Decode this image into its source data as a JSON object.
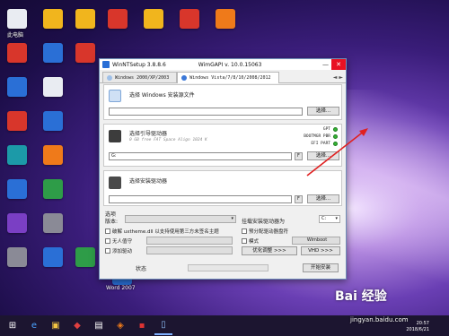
{
  "desktop": {
    "this_pc_label": "此电脑",
    "word_label": "Word 2007"
  },
  "window": {
    "title": "WinNTSetup 3.8.8.6",
    "wimgapi": "WimGAPI v. 10.0.15063",
    "tabs": [
      {
        "label": "Windows 2000/XP/2003"
      },
      {
        "label": "Windows Vista/7/8/10/2008/2012"
      }
    ],
    "tab_arrows": [
      "◄",
      "►"
    ],
    "source": {
      "label": "选择 Windows 安装源文件",
      "value": "",
      "browse_label": "选择..."
    },
    "boot": {
      "label": "选择引导驱动器",
      "sub": "0 GB free FAT Space Align 1024 K",
      "value": "G:",
      "f_label": "F",
      "browse_label": "选择...",
      "status": [
        {
          "name": "GPT"
        },
        {
          "name": "BOOTMGR PBR"
        },
        {
          "name": "EFI PART"
        }
      ]
    },
    "install": {
      "label": "选择安装驱动器",
      "value": "",
      "f_label": "F",
      "browse_label": "选择..."
    },
    "options": {
      "title": "选项",
      "version_label": "版本:",
      "version_value": "",
      "mount_label": "挂载安装驱动器为",
      "mount_value": "C:",
      "uxtheme_label": "破解 uxtheme.dll 以支持使用第三方未签名主题",
      "prealloc_label": "预分配驱动器盘符",
      "unattend_label": "无人值守",
      "mode_label": "模式",
      "mode_value": "Wimboot",
      "add_driver_label": "添加驱动",
      "tweaks_label": "优化调整 >>>",
      "vhd_label": "VHD >>>"
    },
    "status_label": "状态",
    "setup_label": "开始安装"
  },
  "taskbar": {
    "time": "20:57",
    "date": "2018/6/21"
  },
  "watermark": {
    "brand": "Bai 经验",
    "url": "jingyan.baidu.com"
  }
}
